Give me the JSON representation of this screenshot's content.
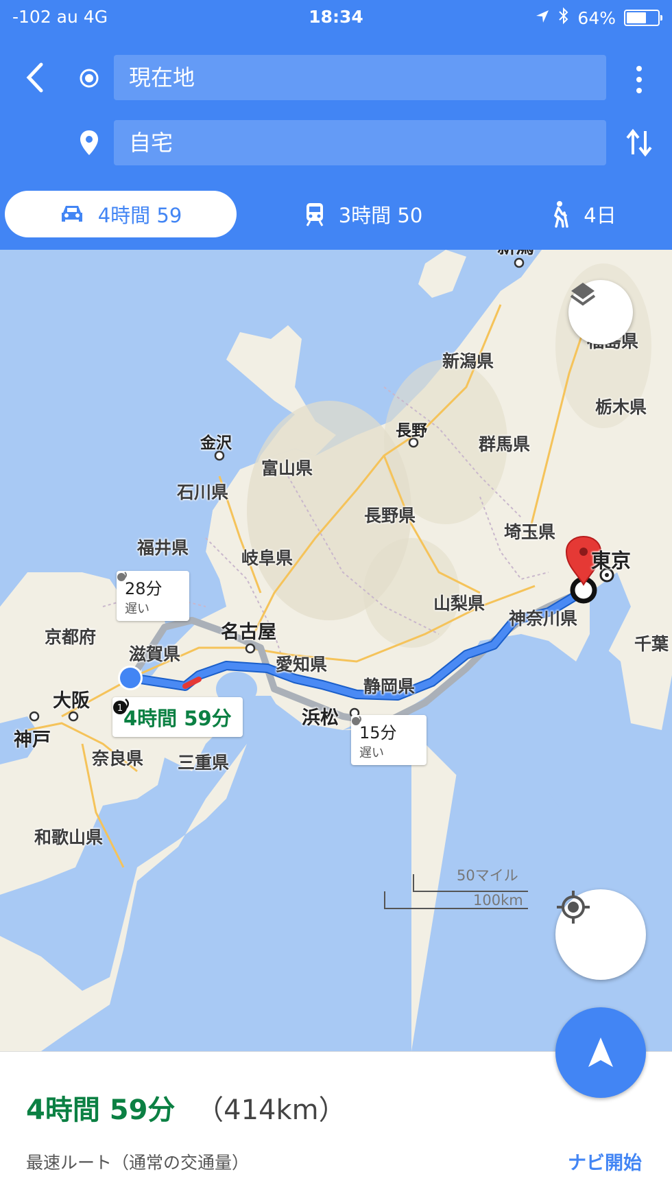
{
  "status_bar": {
    "carrier": "-102 au  4G",
    "time": "18:34",
    "battery": "64%",
    "battery_level": 0.64
  },
  "search": {
    "origin": "現在地",
    "destination": "自宅"
  },
  "modes": [
    {
      "icon": "car-icon",
      "label": "4時間 59",
      "active": true
    },
    {
      "icon": "train-icon",
      "label": "3時間 50",
      "active": false
    },
    {
      "icon": "walk-icon",
      "label": "4日",
      "active": false
    }
  ],
  "map": {
    "labels": {
      "niigata_city": "新潟",
      "fukushima": "福島県",
      "niigata_pref": "新潟県",
      "tochigi": "栃木県",
      "kanazawa": "金沢",
      "nagano_city": "長野",
      "gunma": "群馬県",
      "toyama": "富山県",
      "ishikawa": "石川県",
      "nagano_pref": "長野県",
      "saitama": "埼玉県",
      "fukui": "福井県",
      "gifu": "岐阜県",
      "tokyo": "東京",
      "yamanashi": "山梨県",
      "kyoto": "京都府",
      "nagoya": "名古屋",
      "kanagawa": "神奈川県",
      "chiba": "千葉",
      "shiga": "滋賀県",
      "aichi": "愛知県",
      "shizuoka": "静岡県",
      "osaka": "大阪",
      "hamamatsu": "浜松",
      "kobe": "神戸",
      "nara": "奈良県",
      "mie": "三重県",
      "wakayama": "和歌山県"
    },
    "alt_route_1": {
      "time": "28分",
      "note": "遅い"
    },
    "alt_route_2": {
      "time": "15分",
      "note": "遅い"
    },
    "main_route_label": "4時間 59分",
    "scale": {
      "miles": "50マイル",
      "km": "100km"
    }
  },
  "summary": {
    "duration": "4時間 59分",
    "distance": "（414km）",
    "description": "最速ルート（通常の交通量）",
    "start_nav": "ナビ開始"
  },
  "colors": {
    "header": "#4285f4",
    "route": "#4a8af4",
    "duration_green": "#0b8043"
  }
}
